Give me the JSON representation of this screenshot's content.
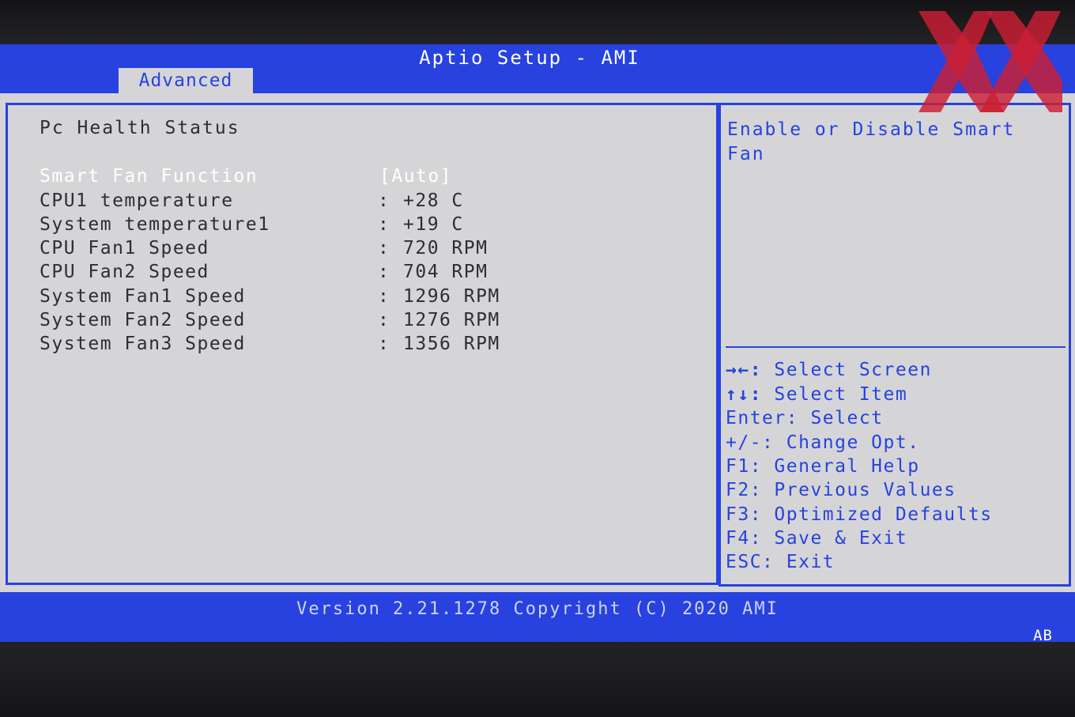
{
  "window": {
    "title": "Aptio Setup - AMI"
  },
  "tabs": [
    {
      "label": "Advanced",
      "active": true
    }
  ],
  "main": {
    "section_title": "Pc Health Status",
    "rows": [
      {
        "label": "Smart Fan Function",
        "separator": "",
        "value": "[Auto]",
        "selected": true
      },
      {
        "label": "CPU1 temperature",
        "separator": ":",
        "value": "+28 C"
      },
      {
        "label": "System temperature1",
        "separator": ":",
        "value": "+19 C"
      },
      {
        "label": "CPU Fan1 Speed",
        "separator": ":",
        "value": "720 RPM"
      },
      {
        "label": "CPU Fan2 Speed",
        "separator": ":",
        "value": "704 RPM"
      },
      {
        "label": "System Fan1 Speed",
        "separator": ":",
        "value": "1296 RPM"
      },
      {
        "label": "System Fan2 Speed",
        "separator": ":",
        "value": "1276 RPM"
      },
      {
        "label": "System Fan3 Speed",
        "separator": ":",
        "value": "1356 RPM"
      }
    ]
  },
  "help": {
    "text": "Enable or Disable Smart Fan",
    "keys": [
      {
        "key": "→←:",
        "action": "Select Screen"
      },
      {
        "key": "↑↓:",
        "action": "Select Item"
      },
      {
        "key": "Enter:",
        "action": "Select"
      },
      {
        "key": "+/-:",
        "action": "Change Opt."
      },
      {
        "key": "F1:",
        "action": "General Help"
      },
      {
        "key": "F2:",
        "action": "Previous Values"
      },
      {
        "key": "F3:",
        "action": "Optimized Defaults"
      },
      {
        "key": "F4:",
        "action": "Save & Exit"
      },
      {
        "key": "ESC:",
        "action": "Exit"
      }
    ]
  },
  "footer": {
    "version": "Version 2.21.1278 Copyright (C) 2020 AMI",
    "badge": "AB"
  },
  "colors": {
    "bios_blue": "#2742df",
    "panel_gray": "#d5d5d7",
    "text_dark": "#2d2d33",
    "highlight_text": "#ffffff",
    "watermark_red": "#cc1f33"
  },
  "watermark": {
    "icon": "hardwareluxx-xx-logo-icon"
  }
}
